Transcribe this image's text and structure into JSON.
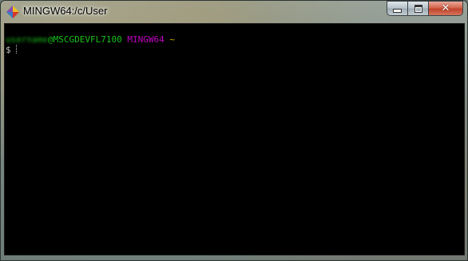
{
  "window": {
    "title": "MINGW64:/c/User",
    "icon": "git-bash-icon"
  },
  "caption_buttons": {
    "minimize_icon": "minimize-icon",
    "maximize_icon": "maximize-icon",
    "close_icon": "close-icon",
    "close_glyph": "✕"
  },
  "terminal": {
    "prompt_user": "username",
    "prompt_host": "@MSCGDEVFL7100",
    "prompt_env": "MINGW64",
    "prompt_cwd": "~",
    "prompt_symbol": "$"
  },
  "colors": {
    "user_host": "#18c018",
    "env": "#c000c0",
    "cwd": "#d0b000",
    "terminal_bg": "#000000"
  }
}
